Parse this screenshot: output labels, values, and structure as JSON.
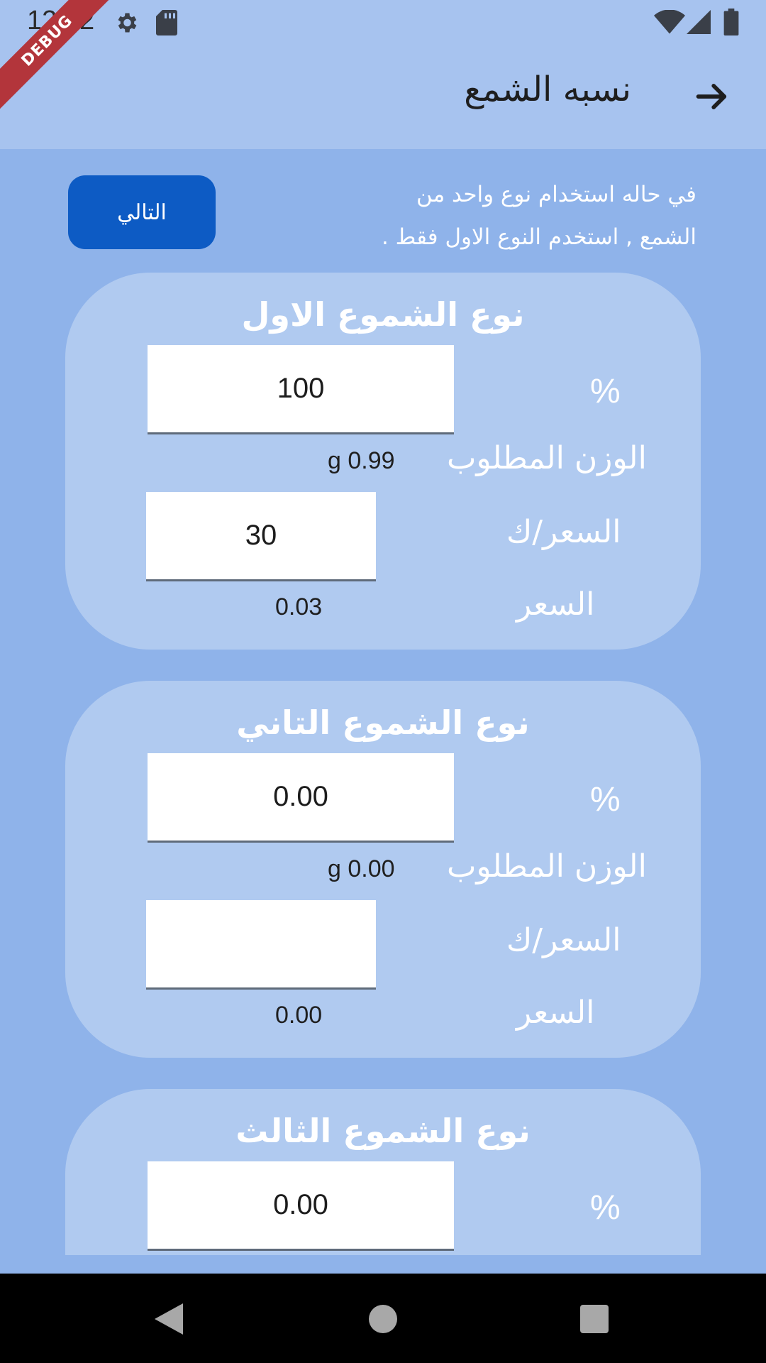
{
  "status_bar": {
    "time": "12:52"
  },
  "debug_banner": "DEBUG",
  "app_bar": {
    "title": "نسبه الشمع",
    "back_icon": "arrow-right-icon"
  },
  "intro": {
    "line1": "في حاله استخدام نوع واحد من",
    "line2": "الشمع , استخدم النوع الاول فقط ."
  },
  "next_button": "التالي",
  "cards": [
    {
      "title": "نوع الشموع الاول",
      "percent_symbol": "%",
      "percent_value": "100",
      "weight_label": "الوزن المطلوب",
      "weight_value": "g 0.99",
      "price_per_kg_label": "السعر/ك",
      "price_per_kg_value": "30",
      "price_label": "السعر",
      "price_value": "0.03"
    },
    {
      "title": "نوع الشموع التاني",
      "percent_symbol": "%",
      "percent_value": "0.00",
      "weight_label": "الوزن المطلوب",
      "weight_value": "g 0.00",
      "price_per_kg_label": "السعر/ك",
      "price_per_kg_value": "",
      "price_label": "السعر",
      "price_value": "0.00"
    },
    {
      "title": "نوع الشموع الثالث",
      "percent_symbol": "%",
      "percent_value": "0.00"
    }
  ]
}
